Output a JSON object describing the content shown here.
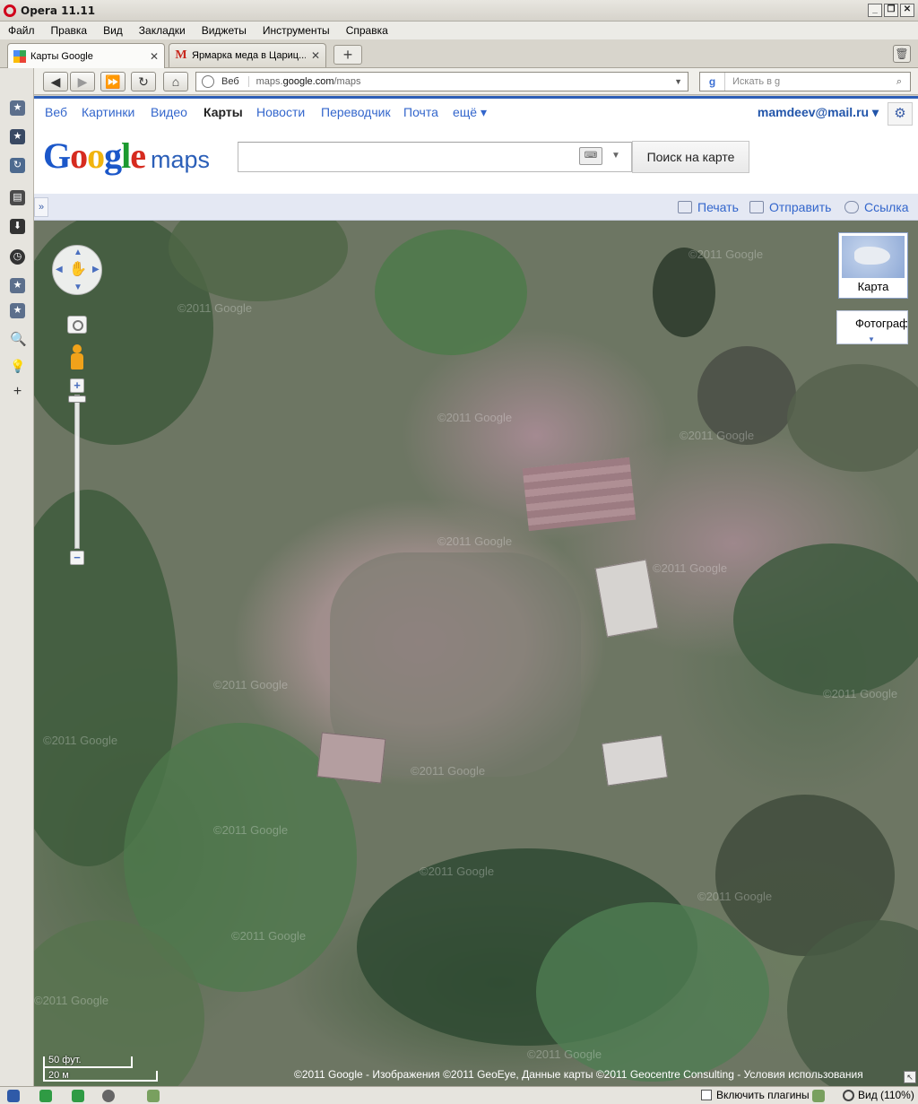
{
  "window": {
    "title": "Opera 11.11",
    "controls": [
      "_",
      "❐",
      "✕"
    ]
  },
  "menu": [
    "Файл",
    "Правка",
    "Вид",
    "Закладки",
    "Виджеты",
    "Инструменты",
    "Справка"
  ],
  "tabs": [
    {
      "title": "Карты Google",
      "favicon": "google-maps-favicon",
      "active": true
    },
    {
      "title": "Ярмарка меда в Цариц...",
      "favicon": "gmail-favicon",
      "favicon_glyph": "M",
      "active": false
    }
  ],
  "newtab_label": "+",
  "address": {
    "scheme_label": "Веб",
    "url_prefix": "maps.",
    "url_domain": "google.com",
    "url_path": "/maps"
  },
  "search": {
    "placeholder": "Искать в g",
    "engine_glyph": "g"
  },
  "gnav": {
    "items": [
      "Веб",
      "Картинки",
      "Видео",
      "Карты",
      "Новости",
      "Переводчик",
      "Почта",
      "ещё ▾"
    ],
    "active_index": 3,
    "user": "mamdeev@mail.ru ▾"
  },
  "maps": {
    "logo_text": "Google",
    "logo_maps": "maps",
    "search_value": "",
    "search_button": "Поиск на карте"
  },
  "actions": {
    "print": "Печать",
    "send": "Отправить",
    "link": "Ссылка"
  },
  "map": {
    "type_label": "Карта",
    "photos_label": "Фотографии",
    "scale_top": "50 фут.",
    "scale_bottom": "20 м",
    "copyright_text": "©2011 Google - Изображения ©2011 GeoEye, Данные карты ©2011 Geocentre Consulting - ",
    "terms_link": "Условия использования",
    "watermark": "©2011 Google"
  },
  "status": {
    "plugins_label": "Включить плагины",
    "zoom_label": "Вид (110%)"
  },
  "colors": {
    "accent": "#2d5fb7",
    "link": "#3366cc",
    "opera_red": "#d0001b"
  }
}
